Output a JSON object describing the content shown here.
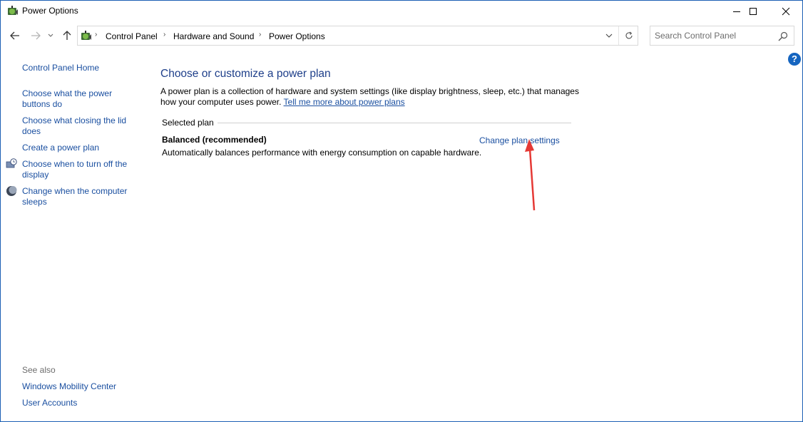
{
  "window": {
    "title": "Power Options",
    "minimize_icon": "minimize-icon",
    "maximize_icon": "maximize-icon",
    "close_icon": "close-icon"
  },
  "address_bar": {
    "breadcrumbs": [
      "Control Panel",
      "Hardware and Sound",
      "Power Options"
    ],
    "search_placeholder": "Search Control Panel"
  },
  "sidebar": {
    "home": "Control Panel Home",
    "items": [
      {
        "label_line1": "Choose what the power",
        "label_line2": "buttons do"
      },
      {
        "label_line1": "Choose what closing the lid",
        "label_line2": "does"
      },
      {
        "label_line1": "Create a power plan",
        "label_line2": ""
      },
      {
        "label_line1": "Choose when to turn off the",
        "label_line2": "display",
        "icon": "display-clock-icon"
      },
      {
        "label_line1": "Change when the computer",
        "label_line2": "sleeps",
        "icon": "sleep-moon-icon"
      }
    ],
    "see_also": {
      "heading": "See also",
      "links": [
        "Windows Mobility Center",
        "User Accounts"
      ]
    }
  },
  "main": {
    "title": "Choose or customize a power plan",
    "description_line1": "A power plan is a collection of hardware and system settings (like display brightness, sleep, etc.) that manages",
    "description_line2": "how your computer uses power.",
    "learn_more": "Tell me more about power plans",
    "selected_plan_label": "Selected plan",
    "plan": {
      "name": "Balanced (recommended)",
      "description": "Automatically balances performance with energy consumption on capable hardware.",
      "change_link": "Change plan settings"
    }
  },
  "colors": {
    "link": "#1a4fa0",
    "title": "#1e3f8a",
    "annotation_arrow": "#e53935",
    "border": "#1b5fb4"
  }
}
